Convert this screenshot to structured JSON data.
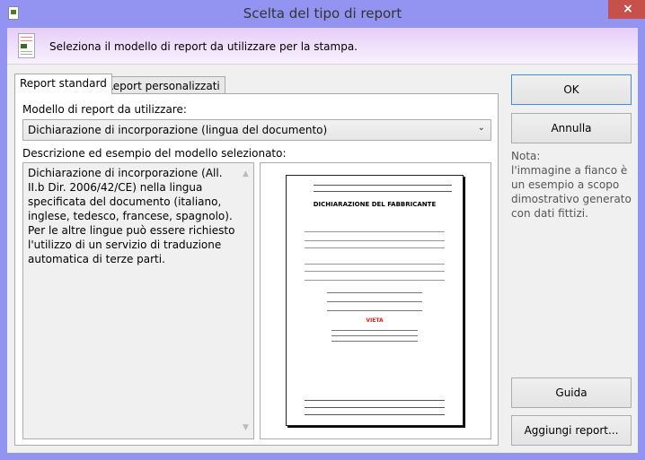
{
  "window": {
    "title": "Scelta del tipo di report",
    "close_label": "×"
  },
  "header": {
    "text": "Seleziona il modello di report da utilizzare per la stampa.",
    "icon": "report-icon"
  },
  "tabs": [
    {
      "label": "Report standard",
      "active": true
    },
    {
      "label": "Report personalizzati",
      "active": false
    }
  ],
  "form": {
    "model_label": "Modello di report da utilizzare:",
    "model_value": "Dichiarazione di incorporazione (lingua del documento)",
    "description_label": "Descrizione ed esempio del modello selezionato:",
    "description": "Dichiarazione di incorporazione (All. II.b Dir. 2006/42/CE) nella lingua specificata del documento (italiano, inglese, tedesco, francese, spagnolo). Per le altre lingue può essere richiesto l'utilizzo di un servizio di traduzione automatica di terze parti."
  },
  "preview": {
    "doc_title": "DICHIARAZIONE DEL FABBRICANTE",
    "red_word": "VIETA",
    "accent": "#e02020"
  },
  "buttons": {
    "ok": "OK",
    "cancel": "Annulla",
    "help": "Guida",
    "add": "Aggiungi report..."
  },
  "note": {
    "title": "Nota:",
    "text": "l'immagine a fianco è un esempio a scopo dimostrativo generato con dati fittizi."
  },
  "colors": {
    "frame": "#9393f2",
    "close": "#c7504a"
  }
}
